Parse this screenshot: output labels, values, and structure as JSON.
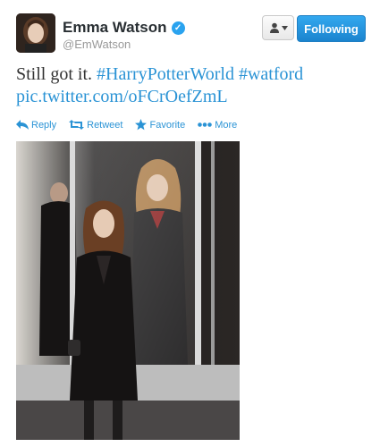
{
  "user": {
    "name": "Emma Watson",
    "handle": "@EmWatson",
    "verified": true,
    "avatar_icon": "profile-photo"
  },
  "buttons": {
    "user_menu_icon": "user-dropdown-icon",
    "follow_label": "Following"
  },
  "tweet": {
    "text": "Still got it.",
    "hashtag1": "#HarryPotterWorld",
    "hashtag2": "#watford",
    "link": "pic.twitter.com/oFCrOefZmL"
  },
  "actions": {
    "reply": "Reply",
    "retweet": "Retweet",
    "favorite": "Favorite",
    "more": "More"
  },
  "colors": {
    "link": "#2a93d5",
    "follow_button": "#1b84ce",
    "verified": "#2aa3ef"
  }
}
